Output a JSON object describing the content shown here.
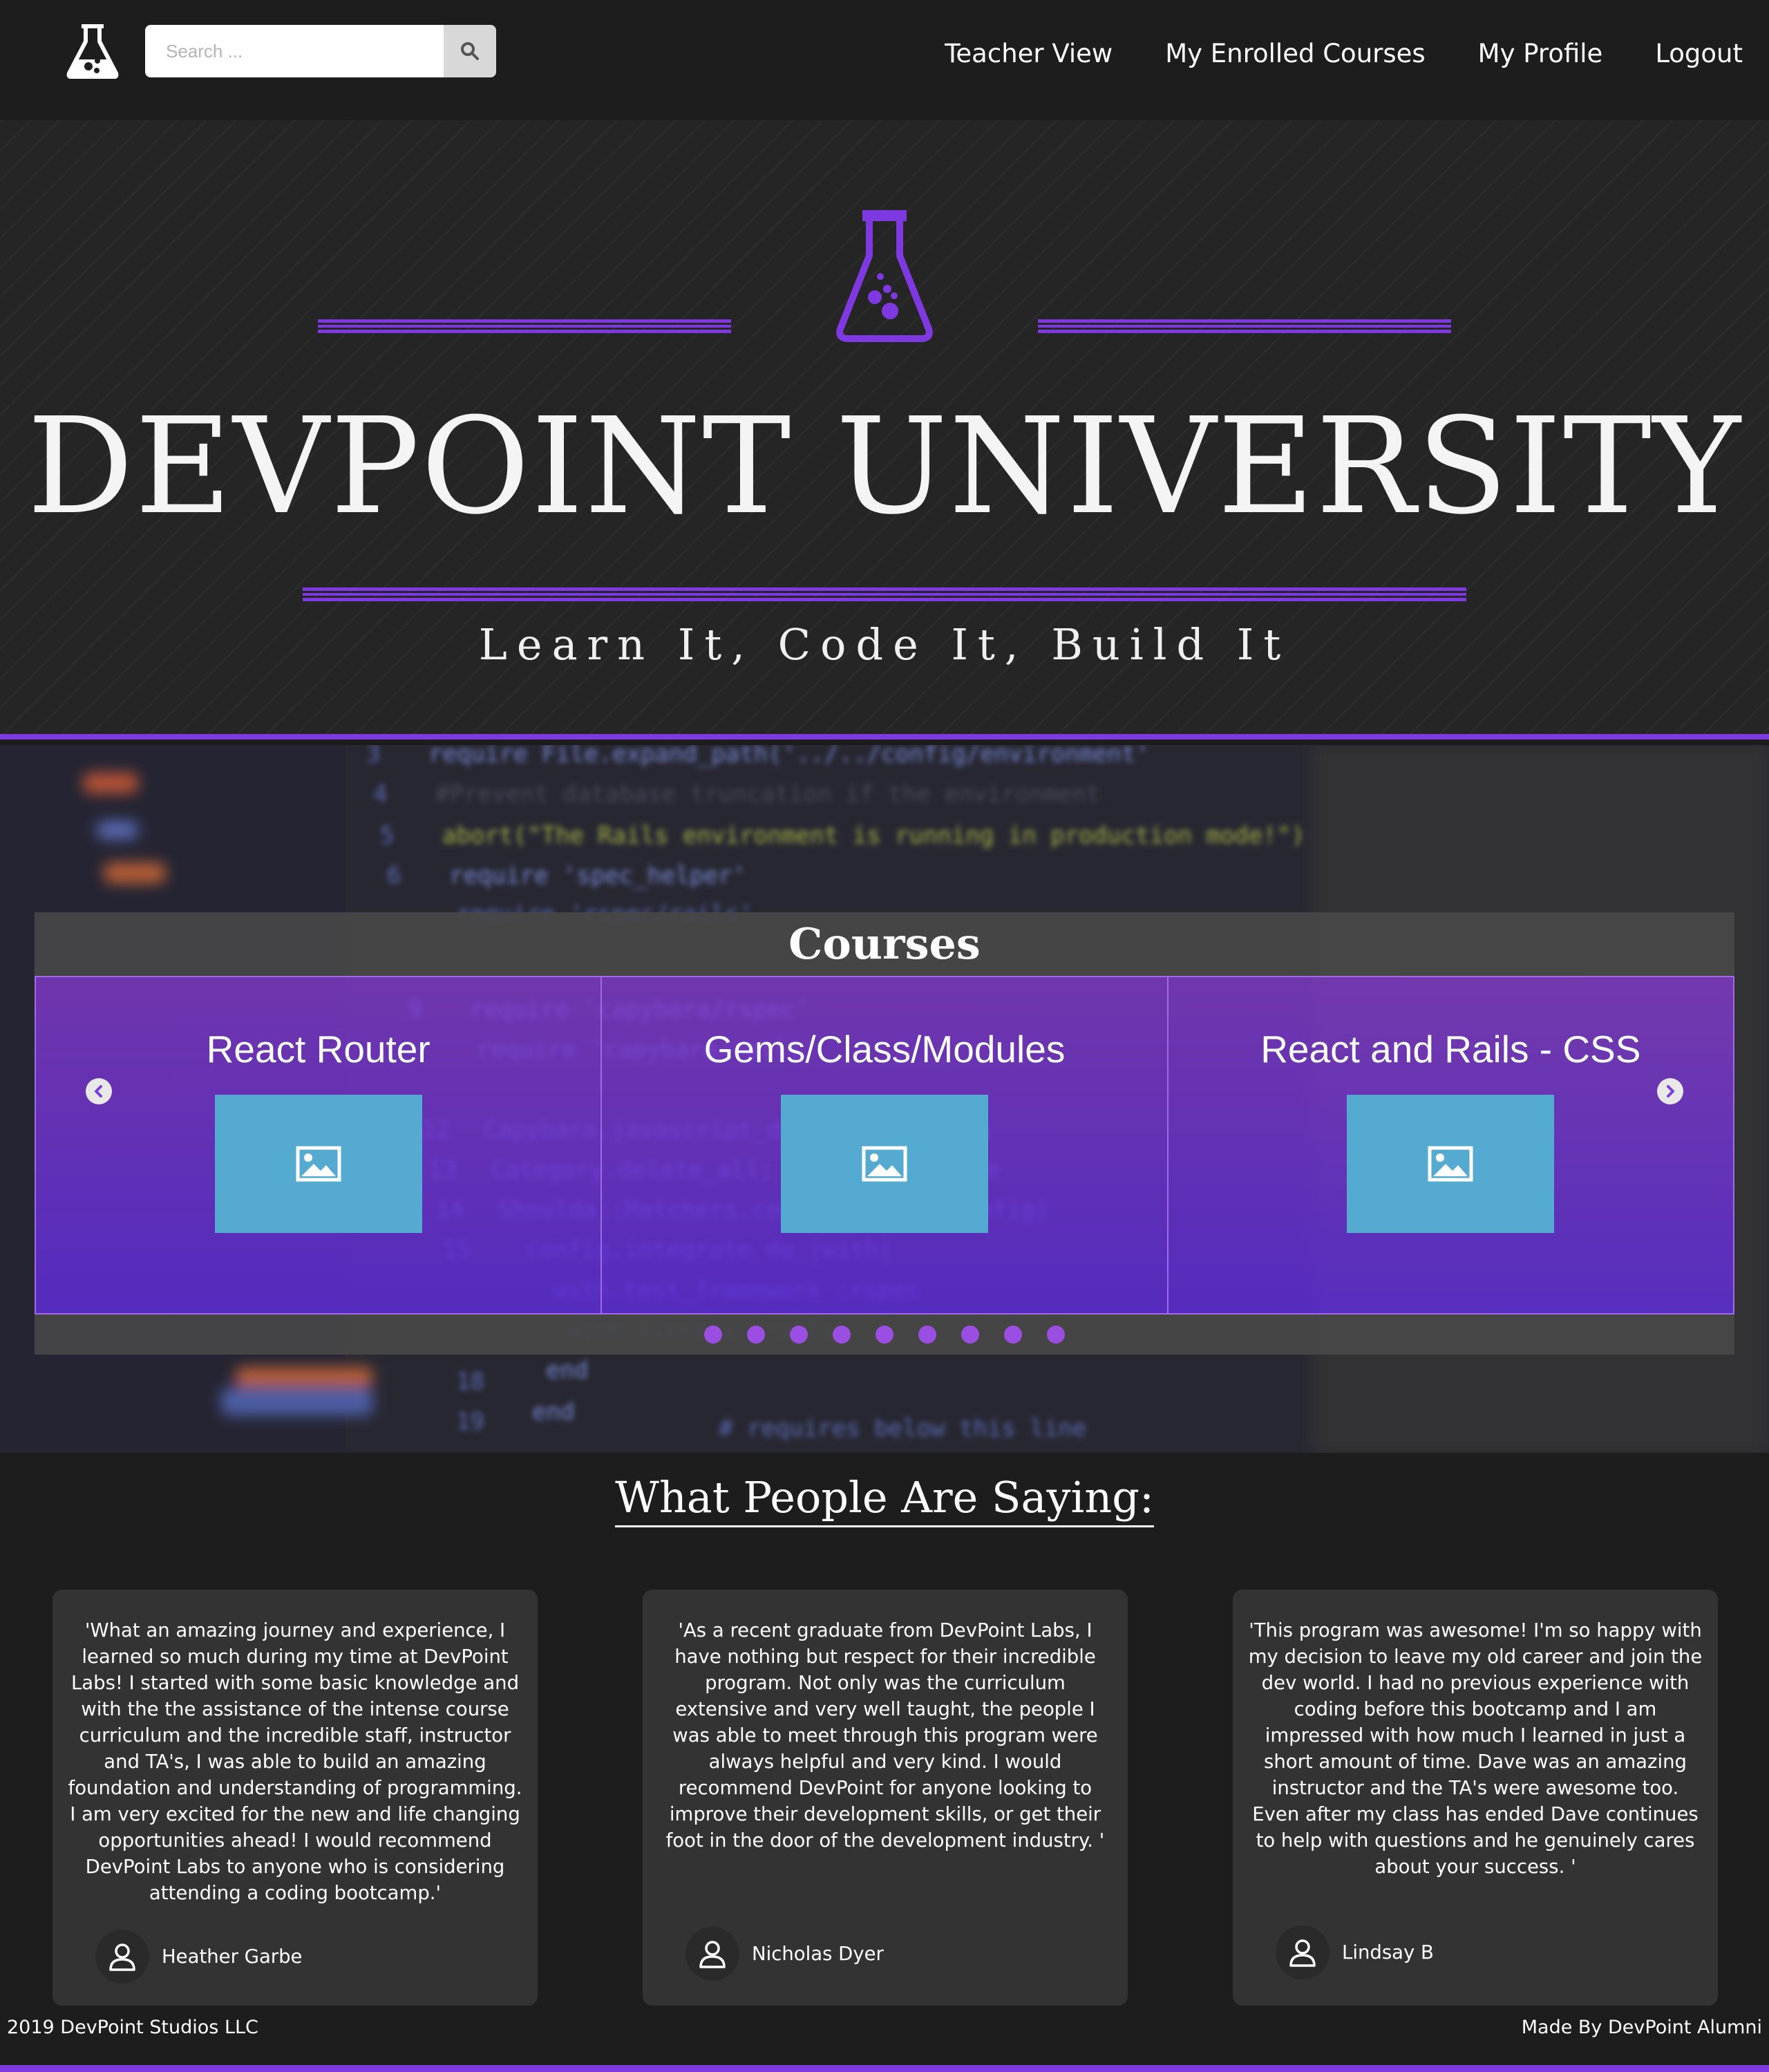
{
  "navbar": {
    "logo_icon": "flask-icon",
    "search": {
      "placeholder": "Search ...",
      "icon": "search-icon"
    },
    "links": [
      "Teacher View",
      "My Enrolled Courses",
      "My Profile",
      "Logout"
    ]
  },
  "hero": {
    "icon": "flask-icon",
    "title": "DEVPOINT UNIVERSITY",
    "tagline": "Learn It, Code It, Build It",
    "accent_color": "#7e3ae0"
  },
  "courses": {
    "title": "Courses",
    "cards": [
      {
        "title": "React Router",
        "image_icon": "image-placeholder-icon"
      },
      {
        "title": "Gems/Class/Modules",
        "image_icon": "image-placeholder-icon"
      },
      {
        "title": "React and Rails - CSS",
        "image_icon": "image-placeholder-icon"
      }
    ],
    "prev_icon": "chevron-left-icon",
    "next_icon": "chevron-right-icon",
    "page_dot_count": 9,
    "background_code": [
      "3",
      "require File.expand_path('../../config/environment'",
      "4",
      "# Prevent database truncation if the environment is production",
      "5",
      "abort(\"The Rails environment is running in production mode!\")",
      "6",
      "require 'spec_helper'",
      "require 'rspec/rails'",
      "9",
      "require 'capybara/rspec'",
      "require 'capybara/rails'",
      "12",
      "Capybara.javascript_driver = :webkit",
      "13",
      "Category.delete_all; Category.create",
      "14",
      "Shoulda::Matchers.configure do |config|",
      "15",
      "config.integrate do |with|",
      "with.test_framework :rspec",
      "with.library :rails",
      "end",
      "18",
      "end",
      "19",
      "# requires below this line",
      "games_feature_spec",
      "book_feature_spec"
    ]
  },
  "testimonials": {
    "heading": "What People Are Saying:",
    "items": [
      {
        "text": "'What an amazing journey and experience, I learned so much during my time at DevPoint Labs! I started with some basic knowledge and with the the assistance of the intense course curriculum and the incredible staff, instructor and TA's, I was able to build an amazing foundation and understanding of programming. I am very excited for the new and life changing opportunities ahead! I would recommend DevPoint Labs to anyone who is considering attending a coding bootcamp.'",
        "author": "Heather Garbe"
      },
      {
        "text": "'As a recent graduate from DevPoint Labs, I have nothing but respect for their incredible program. Not only was the curriculum extensive and very well taught, the people I was able to meet through this program were always helpful and very kind. I would recommend DevPoint for anyone looking to improve their development skills, or get their foot in the door of the development industry. '",
        "author": "Nicholas Dyer"
      },
      {
        "text": "'This program was awesome! I'm so happy with my decision to leave my old career and join the dev world. I had no previous experience with coding before this bootcamp and I am impressed with how much I learned in just a short amount of time. Dave was an amazing instructor and the TA's were awesome too. Even after my class has ended Dave continues to help with questions and he genuinely cares about your success. '",
        "author": "Lindsay B"
      }
    ],
    "avatar_icon": "user-icon"
  },
  "footer": {
    "left": "2019 DevPoint Studios LLC",
    "right": "Made By DevPoint Alumni"
  }
}
